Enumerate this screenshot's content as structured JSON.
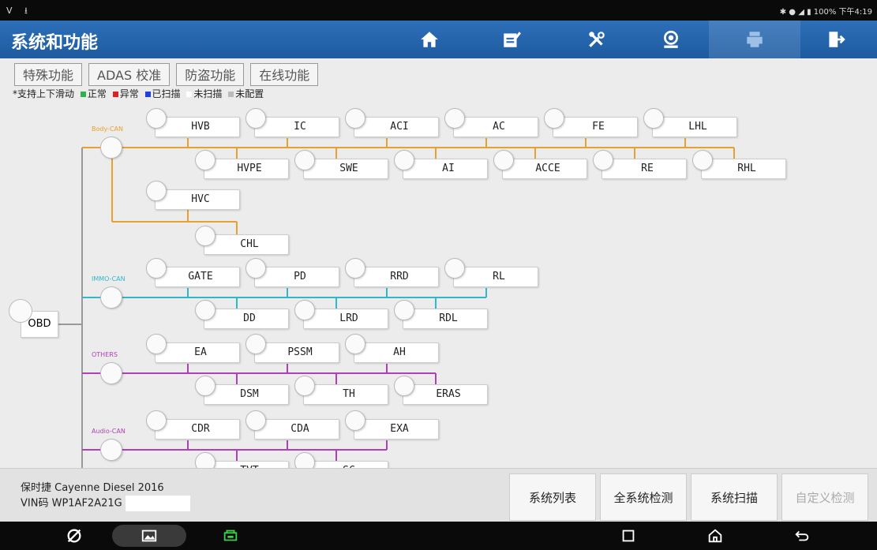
{
  "status_bar": {
    "left_icons": "ᐯ ⭳",
    "right_text": "✱ ● ◢ ▮ 100% 下午4:19"
  },
  "header": {
    "title": "系统和功能",
    "buttons": [
      {
        "name": "home-icon"
      },
      {
        "name": "edit-icon"
      },
      {
        "name": "tools-icon"
      },
      {
        "name": "support-icon"
      },
      {
        "name": "print-icon"
      },
      {
        "name": "exit-icon"
      }
    ]
  },
  "tabs": [
    "特殊功能",
    "ADAS 校准",
    "防盗功能",
    "在线功能"
  ],
  "legend": {
    "prefix": "*支持上下滑动",
    "items": [
      {
        "label": "正常",
        "color": "#2fb24a"
      },
      {
        "label": "异常",
        "color": "#e02020"
      },
      {
        "label": "已扫描",
        "color": "#2040e0"
      },
      {
        "label": "未扫描",
        "color": "#ffffff"
      },
      {
        "label": "未配置",
        "color": "#bbbbbb"
      }
    ]
  },
  "obd": "OBD",
  "buses": [
    {
      "label": "Body-CAN",
      "color": "#e8a030",
      "top": [
        "HVB",
        "IC",
        "ACI",
        "AC",
        "FE",
        "LHL"
      ],
      "bottom": [
        "HVPE",
        "SWE",
        "AI",
        "ACCE",
        "RE",
        "RHL"
      ],
      "extra": [
        "HVC",
        "CHL"
      ]
    },
    {
      "label": "IMMO-CAN",
      "color": "#30b8c8",
      "top": [
        "GATE",
        "PD",
        "RRD",
        "RL"
      ],
      "bottom": [
        "DD",
        "LRD",
        "RDL"
      ]
    },
    {
      "label": "OTHERS",
      "color": "#b040b8",
      "top": [
        "EA",
        "PSSM",
        "AH"
      ],
      "bottom": [
        "DSM",
        "TH",
        "ERAS"
      ]
    },
    {
      "label": "Audio-CAN",
      "color": "#b040b8",
      "top": [
        "CDR",
        "CDA",
        "EXA"
      ],
      "bottom": [
        "TVT",
        "SC"
      ]
    }
  ],
  "footer": {
    "vehicle": "保时捷 Cayenne Diesel 2016",
    "vin": "VIN码 WP1AF2A21G",
    "buttons": [
      "系统列表",
      "全系统检测",
      "系统扫描",
      "自定义检测"
    ]
  },
  "nav": [
    {
      "name": "browser-icon"
    },
    {
      "name": "gallery-icon"
    },
    {
      "name": "vci-icon"
    },
    {
      "name": "recent-apps-icon"
    },
    {
      "name": "home-nav-icon"
    },
    {
      "name": "back-icon"
    }
  ]
}
